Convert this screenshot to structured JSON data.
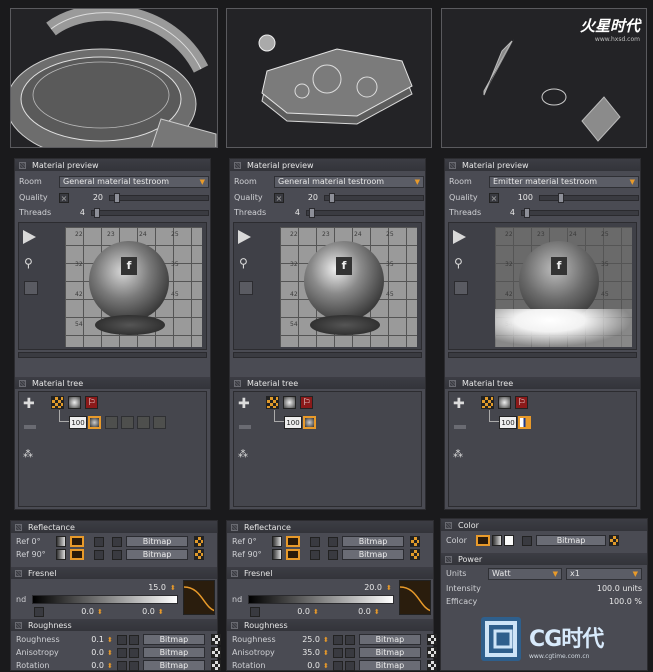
{
  "watermark_top": {
    "brand": "火星时代",
    "url": "www.hxsd.com"
  },
  "watermark_bottom": {
    "brand": "CG时代",
    "url": "www.cgtime.com.cn"
  },
  "colors": {
    "accent": "#e89a2a",
    "panel_bg": "#4a4b53",
    "header_bg": "#36373d",
    "app_bg": "#1a1a1c"
  },
  "previews": [
    {
      "title": "Material preview",
      "room_label": "Room",
      "room_value": "General material testroom",
      "quality_label": "Quality",
      "quality_value": "20",
      "threads_label": "Threads",
      "threads_value": "4",
      "tree_title": "Material tree",
      "node_value": "100",
      "render_tiles": [
        "22",
        "23",
        "24",
        "25",
        "32",
        "33",
        "34",
        "35",
        "42",
        "43",
        "44",
        "45",
        "54"
      ]
    },
    {
      "title": "Material preview",
      "room_label": "Room",
      "room_value": "General material testroom",
      "quality_label": "Quality",
      "quality_value": "20",
      "threads_label": "Threads",
      "threads_value": "4",
      "tree_title": "Material tree",
      "node_value": "100",
      "render_tiles": [
        "22",
        "23",
        "24",
        "25",
        "32",
        "33",
        "34",
        "35",
        "42",
        "43",
        "44",
        "45",
        "54"
      ]
    },
    {
      "title": "Material preview",
      "room_label": "Room",
      "room_value": "Emitter material testroom",
      "quality_label": "Quality",
      "quality_value": "100",
      "threads_label": "Threads",
      "threads_value": "4",
      "tree_title": "Material tree",
      "node_value": "100",
      "render_tiles": [
        "22",
        "23",
        "24",
        "25",
        "32",
        "33",
        "34",
        "35",
        "42",
        "43",
        "44",
        "45",
        "54"
      ]
    }
  ],
  "props": [
    {
      "reflectance_title": "Reflectance",
      "ref0_label": "Ref 0°",
      "ref90_label": "Ref 90°",
      "bitmap": "Bitmap",
      "fresnel_title": "Fresnel",
      "nd_label": "nd",
      "nd_value": "15.0",
      "low_a": "0.0",
      "low_b": "0.0",
      "roughness_title": "Roughness",
      "rows": [
        {
          "label": "Roughness",
          "value": "0.1"
        },
        {
          "label": "Anisotropy",
          "value": "0.0"
        },
        {
          "label": "Rotation",
          "value": "0.0"
        }
      ]
    },
    {
      "reflectance_title": "Reflectance",
      "ref0_label": "Ref 0°",
      "ref90_label": "Ref 90°",
      "bitmap": "Bitmap",
      "fresnel_title": "Fresnel",
      "nd_label": "nd",
      "nd_value": "20.0",
      "low_a": "0.0",
      "low_b": "0.0",
      "roughness_title": "Roughness",
      "rows": [
        {
          "label": "Roughness",
          "value": "25.0"
        },
        {
          "label": "Anisotropy",
          "value": "35.0"
        },
        {
          "label": "Rotation",
          "value": "0.0"
        }
      ]
    }
  ],
  "emitter": {
    "color_title": "Color",
    "color_label": "Color",
    "bitmap": "Bitmap",
    "power_title": "Power",
    "units_label": "Units",
    "units_value": "Watt",
    "mult_value": "x1",
    "intensity_label": "Intensity",
    "intensity_value": "100.0 units",
    "efficacy_label": "Efficacy",
    "efficacy_value": "100.0 %"
  }
}
